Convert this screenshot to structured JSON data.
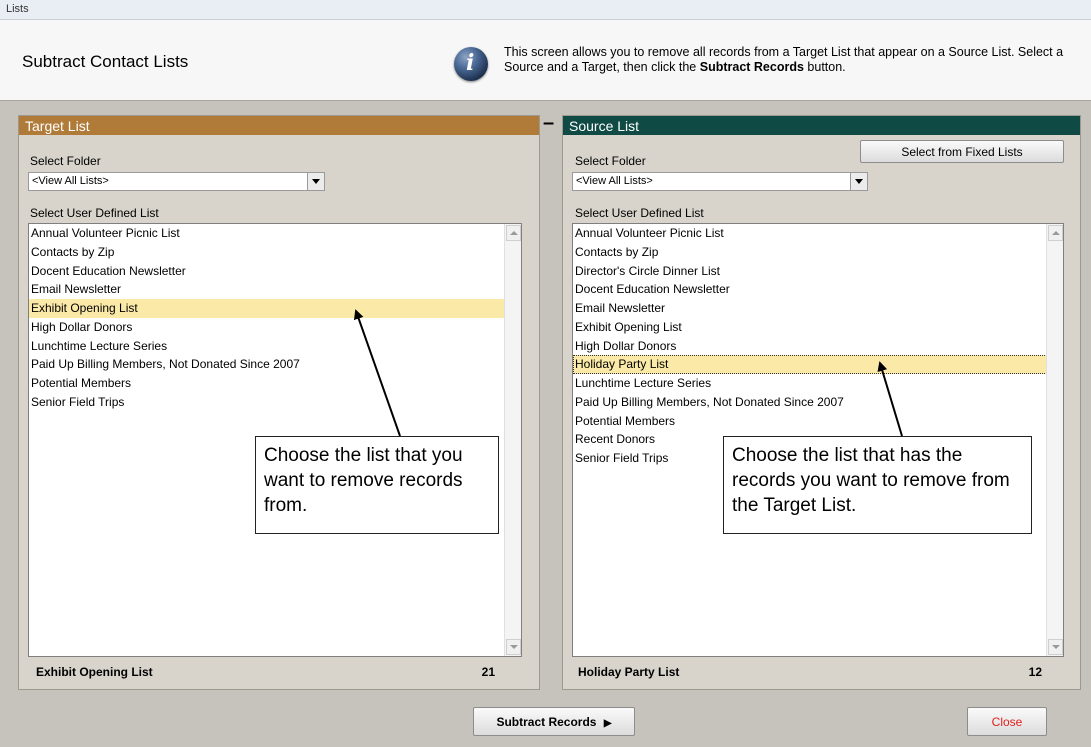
{
  "window": {
    "title": "Lists"
  },
  "header": {
    "title": "Subtract Contact Lists",
    "info_text_1": "This screen allows you to remove all records from a Target List that appear on a Source List.  Select a Source and a Target, then click the ",
    "info_text_bold": "Subtract Records",
    "info_text_2": " button."
  },
  "operator": "–",
  "target": {
    "header": "Target List",
    "folder_label": "Select Folder",
    "folder_value": "<View All Lists>",
    "list_label": "Select User Defined List",
    "items": [
      "Annual Volunteer Picnic List",
      "Contacts by Zip",
      "Docent Education Newsletter",
      "Email Newsletter",
      "Exhibit Opening List",
      "High Dollar Donors",
      "Lunchtime Lecture Series",
      "Paid Up Billing Members, Not Donated Since 2007",
      "Potential Members",
      "Senior Field Trips"
    ],
    "selected_index": 4,
    "selected_name": "Exhibit Opening List",
    "count": "21",
    "callout": "Choose the list that you want to remove records from."
  },
  "source": {
    "header": "Source List",
    "fixed_button": "Select from Fixed Lists",
    "folder_label": "Select Folder",
    "folder_value": "<View All Lists>",
    "list_label": "Select User Defined List",
    "items": [
      "Annual Volunteer Picnic List",
      "Contacts by Zip",
      "Director's Circle Dinner List",
      "Docent Education Newsletter",
      "Email Newsletter",
      "Exhibit Opening List",
      "High Dollar Donors",
      "Holiday Party List",
      "Lunchtime Lecture Series",
      "Paid Up Billing Members, Not Donated Since 2007",
      "Potential Members",
      "Recent Donors",
      "Senior Field Trips"
    ],
    "selected_index": 7,
    "selected_name": "Holiday Party List",
    "count": "12",
    "callout": "Choose the list that has the records you want to remove from the Target List."
  },
  "actions": {
    "subtract_label": "Subtract Records",
    "subtract_arrow": "▶",
    "close_label": "Close"
  },
  "colors": {
    "target_header": "#b07a38",
    "source_header": "#0f4a44",
    "selection": "#fbe9a8",
    "close_text": "#e0201c"
  }
}
